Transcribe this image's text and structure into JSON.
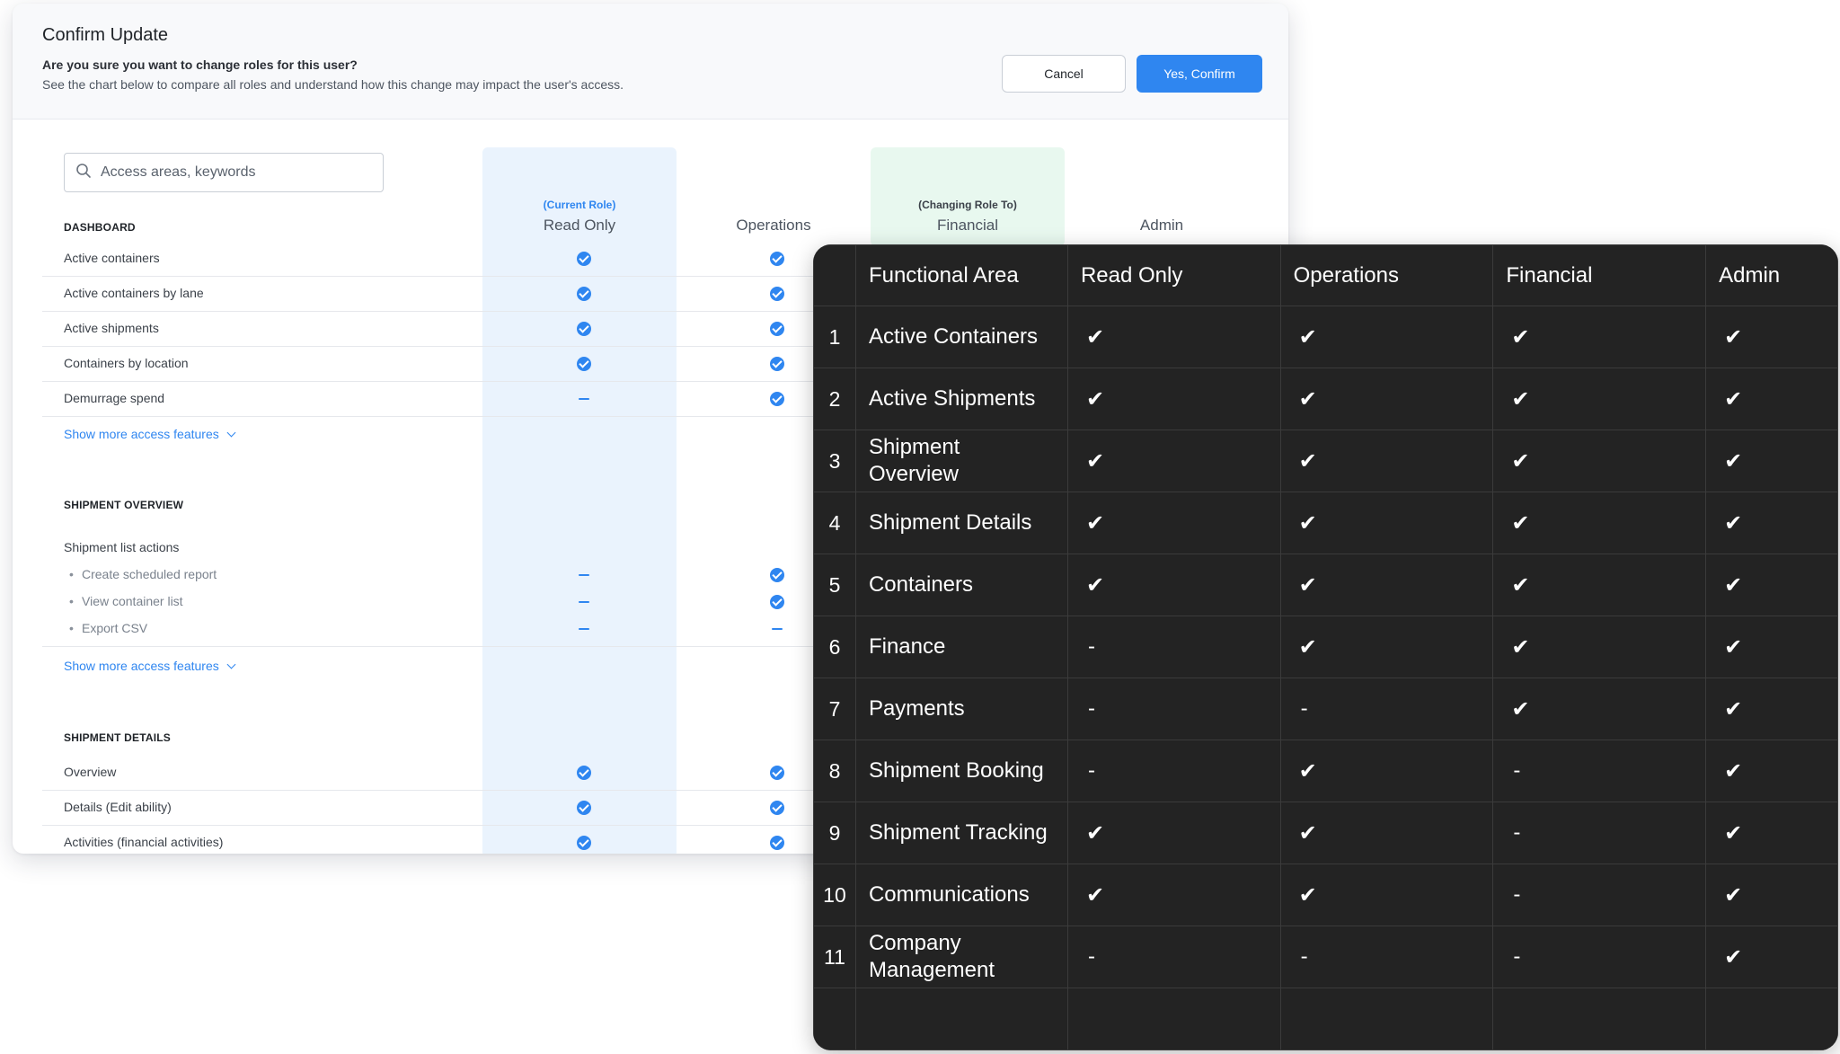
{
  "modal": {
    "title": "Confirm Update",
    "question": "Are you sure you want to change roles for this user?",
    "description": "See the chart below to compare all roles and understand how this change may impact the user's access.",
    "cancel_label": "Cancel",
    "confirm_label": "Yes, Confirm"
  },
  "search": {
    "placeholder": "Access areas, keywords"
  },
  "role_columns": [
    {
      "tag": "(Current Role)",
      "name": "Read Only",
      "tag_color": "#2f86f0"
    },
    {
      "tag": "",
      "name": "Operations"
    },
    {
      "tag": "(Changing Role To)",
      "name": "Financial",
      "tag_color": "#3b4149"
    },
    {
      "tag": "",
      "name": "Admin"
    }
  ],
  "sections": [
    {
      "title": "DASHBOARD",
      "rows": [
        {
          "label": "Active containers",
          "read_only": "check",
          "operations": "check"
        },
        {
          "label": "Active containers by lane",
          "read_only": "check",
          "operations": "check"
        },
        {
          "label": "Active shipments",
          "read_only": "check",
          "operations": "check"
        },
        {
          "label": "Containers by location",
          "read_only": "check",
          "operations": "check"
        },
        {
          "label": "Demurrage spend",
          "read_only": "dash",
          "operations": "check"
        }
      ],
      "show_more": "Show more access features"
    },
    {
      "title": "SHIPMENT OVERVIEW",
      "rows": [
        {
          "label": "Shipment list actions"
        },
        {
          "label": "Create scheduled report",
          "read_only": "dash",
          "operations": "check"
        },
        {
          "label": "View container list",
          "read_only": "dash",
          "operations": "check"
        },
        {
          "label": "Export CSV",
          "read_only": "dash",
          "operations": "dash"
        }
      ],
      "show_more": "Show more access features"
    },
    {
      "title": "SHIPMENT DETAILS",
      "rows": [
        {
          "label": "Overview",
          "read_only": "check",
          "operations": "check"
        },
        {
          "label": "Details (Edit ability)",
          "read_only": "check",
          "operations": "check"
        },
        {
          "label": "Activities (financial activities)",
          "read_only": "check",
          "operations": "check"
        }
      ]
    }
  ],
  "dark_table": {
    "headers": [
      "Functional Area",
      "Read Only",
      "Operations",
      "Financial",
      "Admin"
    ],
    "rows": [
      {
        "n": "1",
        "area": "Active Containers",
        "vals": [
          "✔",
          "✔",
          "✔",
          "✔"
        ]
      },
      {
        "n": "2",
        "area": "Active Shipments",
        "vals": [
          "✔",
          "✔",
          "✔",
          "✔"
        ]
      },
      {
        "n": "3",
        "area": "Shipment Overview",
        "vals": [
          "✔",
          "✔",
          "✔",
          "✔"
        ]
      },
      {
        "n": "4",
        "area": "Shipment Details",
        "vals": [
          "✔",
          "✔",
          "✔",
          "✔"
        ]
      },
      {
        "n": "5",
        "area": "Containers",
        "vals": [
          "✔",
          "✔",
          "✔",
          "✔"
        ]
      },
      {
        "n": "6",
        "area": "Finance",
        "vals": [
          "-",
          "✔",
          "✔",
          "✔"
        ]
      },
      {
        "n": "7",
        "area": "Payments",
        "vals": [
          "-",
          "-",
          "✔",
          "✔"
        ]
      },
      {
        "n": "8",
        "area": "Shipment Booking",
        "vals": [
          "-",
          "✔",
          "-",
          "✔"
        ]
      },
      {
        "n": "9",
        "area": "Shipment Tracking",
        "vals": [
          "✔",
          "✔",
          "-",
          "✔"
        ]
      },
      {
        "n": "10",
        "area": "Communications",
        "vals": [
          "✔",
          "✔",
          "-",
          "✔"
        ]
      },
      {
        "n": "11",
        "area": "Company Management",
        "vals": [
          "-",
          "-",
          "-",
          "✔"
        ]
      }
    ]
  }
}
